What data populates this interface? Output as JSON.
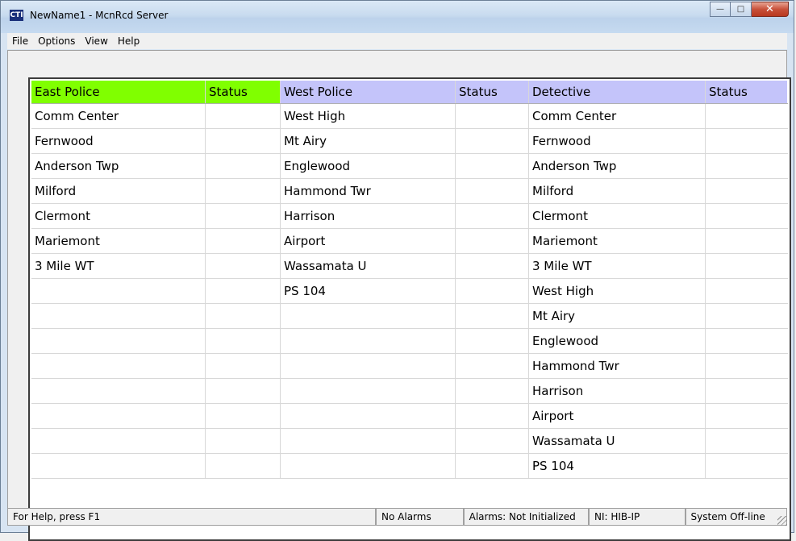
{
  "window": {
    "title": "NewName1 - McnRcd Server",
    "app_icon": "CTI"
  },
  "menu": [
    "File",
    "Options",
    "View",
    "Help"
  ],
  "grid": {
    "columns": [
      "East Police",
      "Status",
      "West Police",
      "Status",
      "Detective",
      "Status"
    ],
    "east_color": "#80ff00",
    "west_color": "#c4c4fa",
    "rows": [
      [
        "Comm Center",
        "",
        "West High",
        "",
        "Comm Center",
        ""
      ],
      [
        "Fernwood",
        "",
        "Mt Airy",
        "",
        "Fernwood",
        ""
      ],
      [
        "Anderson Twp",
        "",
        "Englewood",
        "",
        "Anderson Twp",
        ""
      ],
      [
        "Milford",
        "",
        "Hammond Twr",
        "",
        "Milford",
        ""
      ],
      [
        "Clermont",
        "",
        "Harrison",
        "",
        "Clermont",
        ""
      ],
      [
        "Mariemont",
        "",
        "Airport",
        "",
        "Mariemont",
        ""
      ],
      [
        "3 Mile WT",
        "",
        "Wassamata U",
        "",
        "3 Mile WT",
        ""
      ],
      [
        "",
        "",
        "PS 104",
        "",
        "West High",
        ""
      ],
      [
        "",
        "",
        "",
        "",
        "Mt Airy",
        ""
      ],
      [
        "",
        "",
        "",
        "",
        "Englewood",
        ""
      ],
      [
        "",
        "",
        "",
        "",
        "Hammond Twr",
        ""
      ],
      [
        "",
        "",
        "",
        "",
        "Harrison",
        ""
      ],
      [
        "",
        "",
        "",
        "",
        "Airport",
        ""
      ],
      [
        "",
        "",
        "",
        "",
        "Wassamata U",
        ""
      ],
      [
        "",
        "",
        "",
        "",
        "PS 104",
        ""
      ]
    ]
  },
  "statusbar": {
    "help": "For Help, press F1",
    "alarms": "No Alarms",
    "alarms_state": "Alarms: Not Initialized",
    "ni": "NI: HIB-IP",
    "system": "System Off-line"
  }
}
